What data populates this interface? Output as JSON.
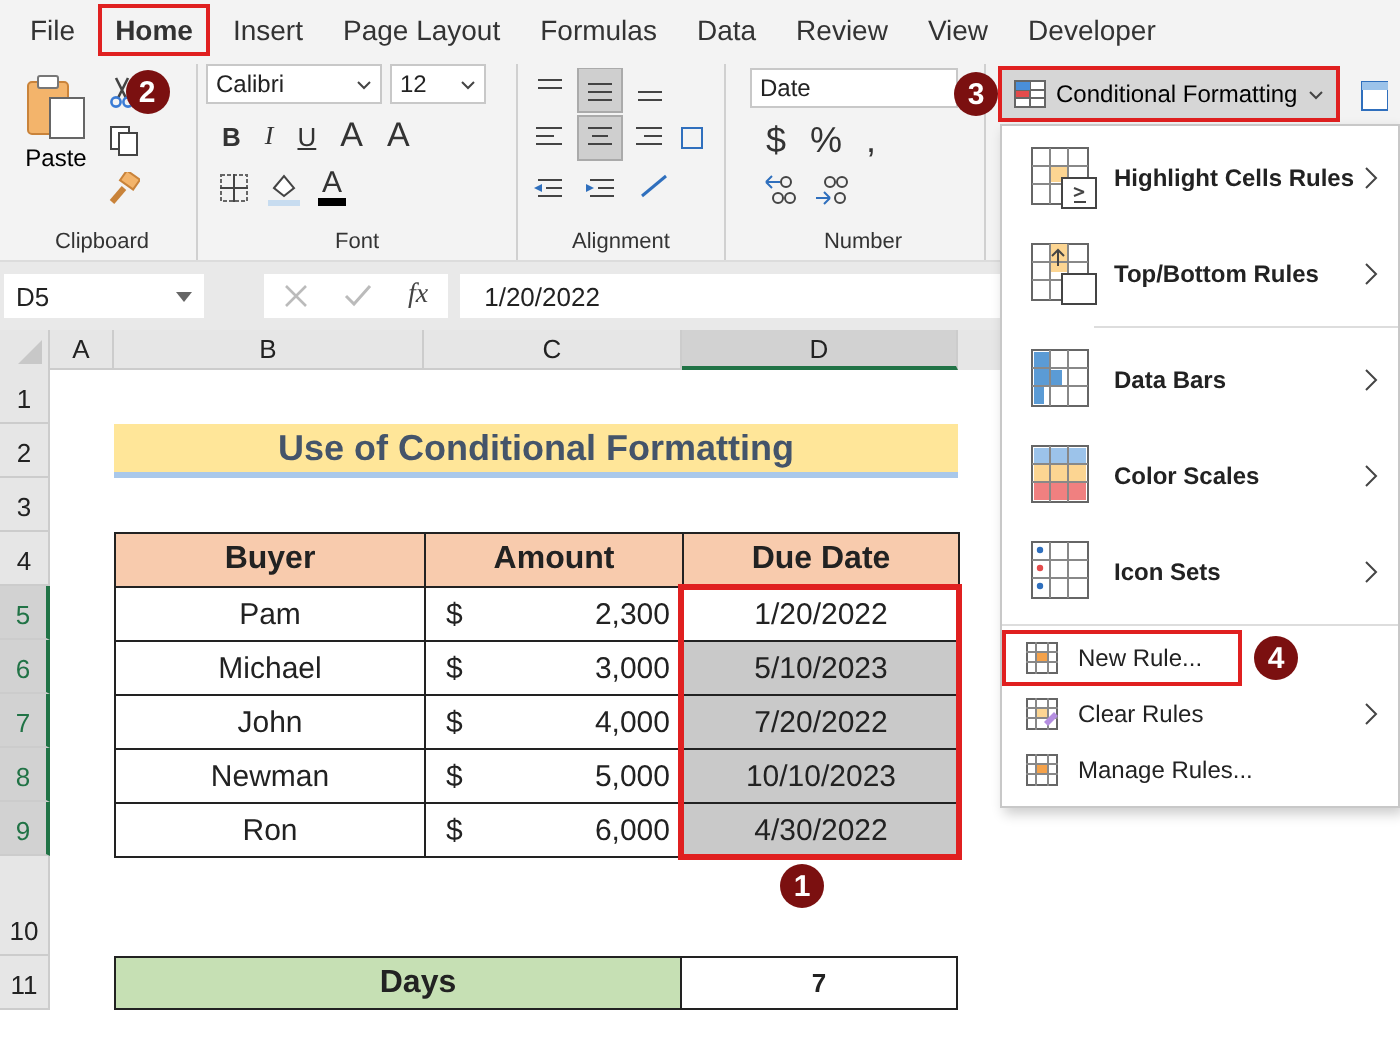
{
  "menu_tabs": [
    {
      "label": "File",
      "selected": false
    },
    {
      "label": "Home",
      "selected": true,
      "callout": "2"
    },
    {
      "label": "Insert",
      "selected": false
    },
    {
      "label": "Page Layout",
      "selected": false
    },
    {
      "label": "Formulas",
      "selected": false
    },
    {
      "label": "Data",
      "selected": false
    },
    {
      "label": "Review",
      "selected": false
    },
    {
      "label": "View",
      "selected": false
    },
    {
      "label": "Developer",
      "selected": false
    }
  ],
  "ribbon": {
    "clipboard": {
      "paste_label": "Paste",
      "group_label": "Clipboard"
    },
    "font": {
      "font_name": "Calibri",
      "font_size": "12",
      "style_buttons": [
        "B",
        "I",
        "U"
      ],
      "grow_letter": "A",
      "shrink_letter": "A",
      "color_letter": "A",
      "group_label": "Font"
    },
    "alignment": {
      "group_label": "Alignment"
    },
    "number": {
      "format": "Date",
      "symbols": [
        "$",
        "%",
        ","
      ],
      "group_label": "Number"
    },
    "conditional_formatting": {
      "label": "Conditional Formatting",
      "expanded": true,
      "callout": "3"
    }
  },
  "formula_bar": {
    "name_box": "D5",
    "function_label": "fx",
    "value": "1/20/2022"
  },
  "columns": [
    {
      "label": "A",
      "selected": false
    },
    {
      "label": "B",
      "selected": false
    },
    {
      "label": "C",
      "selected": false
    },
    {
      "label": "D",
      "selected": true
    }
  ],
  "row_numbers": [
    {
      "label": "1",
      "selected": false
    },
    {
      "label": "2",
      "selected": false
    },
    {
      "label": "3",
      "selected": false
    },
    {
      "label": "4",
      "selected": false
    },
    {
      "label": "5",
      "selected": true
    },
    {
      "label": "6",
      "selected": true
    },
    {
      "label": "7",
      "selected": true
    },
    {
      "label": "8",
      "selected": true
    },
    {
      "label": "9",
      "selected": true
    },
    {
      "label": "10",
      "selected": false
    },
    {
      "label": "11",
      "selected": false
    }
  ],
  "sheet": {
    "title": "Use of Conditional Formatting",
    "headers": [
      "Buyer",
      "Amount",
      "Due Date"
    ],
    "rows": [
      {
        "buyer": "Pam",
        "currency": "$",
        "amount": "2,300",
        "due_date": "1/20/2022",
        "shaded": false
      },
      {
        "buyer": "Michael",
        "currency": "$",
        "amount": "3,000",
        "due_date": "5/10/2023",
        "shaded": true
      },
      {
        "buyer": "John",
        "currency": "$",
        "amount": "4,000",
        "due_date": "7/20/2022",
        "shaded": true
      },
      {
        "buyer": "Newman",
        "currency": "$",
        "amount": "5,000",
        "due_date": "10/10/2023",
        "shaded": true
      },
      {
        "buyer": "Ron",
        "currency": "$",
        "amount": "6,000",
        "due_date": "4/30/2022",
        "shaded": true
      }
    ],
    "range_callout": "1",
    "days": {
      "label": "Days",
      "value": "7"
    }
  },
  "menu": {
    "items": [
      {
        "kind": "large",
        "label": "Highlight Cells Rules",
        "submenu": true
      },
      {
        "kind": "large",
        "label": "Top/Bottom Rules",
        "submenu": true
      },
      {
        "kind": "large",
        "label": "Data Bars",
        "submenu": true
      },
      {
        "kind": "large",
        "label": "Color Scales",
        "submenu": true
      },
      {
        "kind": "large",
        "label": "Icon Sets",
        "submenu": true
      },
      {
        "kind": "small",
        "label": "New Rule...",
        "submenu": false,
        "callout": "4"
      },
      {
        "kind": "small",
        "label": "Clear Rules",
        "submenu": true
      },
      {
        "kind": "small",
        "label": "Manage Rules...",
        "submenu": false
      }
    ]
  }
}
